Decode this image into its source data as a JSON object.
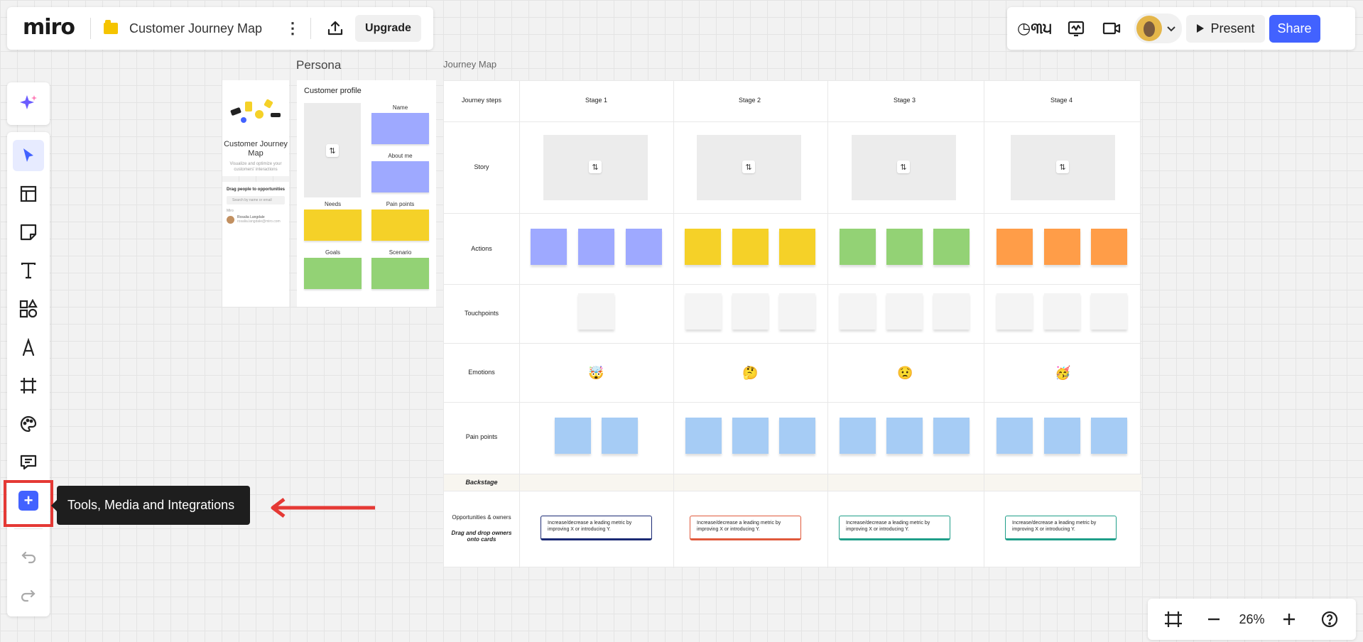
{
  "app": {
    "logo": "miro",
    "board_title": "Customer Journey Map",
    "upgrade_label": "Upgrade",
    "present_label": "Present",
    "share_label": "Share",
    "reactions_glyph": "◷୩੫",
    "kebab_glyph": "⋮",
    "accent_color": "#4262ff"
  },
  "tooltip": {
    "text": "Tools, Media and Integrations"
  },
  "zoom": {
    "level": "26%"
  },
  "canvas": {
    "persona_label": "Persona",
    "journey_map_label": "Journey Map",
    "persona_card": {
      "title": "Customer Journey Map",
      "subtitle": "Visualize and optimize your customers' interactions"
    },
    "drag_panel": {
      "title": "Drag people to opportunities",
      "search_placeholder": "Search by name or email",
      "section": "Miro",
      "user_name": "Rosalia Langdale",
      "user_email": "rosalia.langdale@miro.com"
    },
    "profile": {
      "title": "Customer profile",
      "name_label": "Name",
      "about_label": "About me",
      "needs_label": "Needs",
      "pain_label": "Pain points",
      "goals_label": "Goals",
      "scenario_label": "Scenario"
    },
    "journey": {
      "header_label": "Journey steps",
      "stages": [
        "Stage 1",
        "Stage 2",
        "Stage 3",
        "Stage 4"
      ],
      "rows": {
        "story": "Story",
        "actions": "Actions",
        "touchpoints": "Touchpoints",
        "emotions": "Emotions",
        "pain_points": "Pain points",
        "backstage": "Backstage",
        "opportunities": "Opportunities & owners",
        "opportunities_hint": "Drag and drop owners onto cards"
      },
      "emotions": [
        "🤯",
        "🤔",
        "😟",
        "🥳"
      ],
      "opportunity_text": "Increase/decrease a leading metric by improving X or introducing Y.",
      "stage_colors": [
        "#9ea9ff",
        "#f5d128",
        "#93d275",
        "#ff9d48"
      ],
      "pain_color": "#a6ccf5",
      "touchpoint_color": "#f4f4f4",
      "opportunity_border_colors": [
        "#1b2a74",
        "#e0593b",
        "#1f9e89",
        "#1f9e89"
      ]
    }
  }
}
